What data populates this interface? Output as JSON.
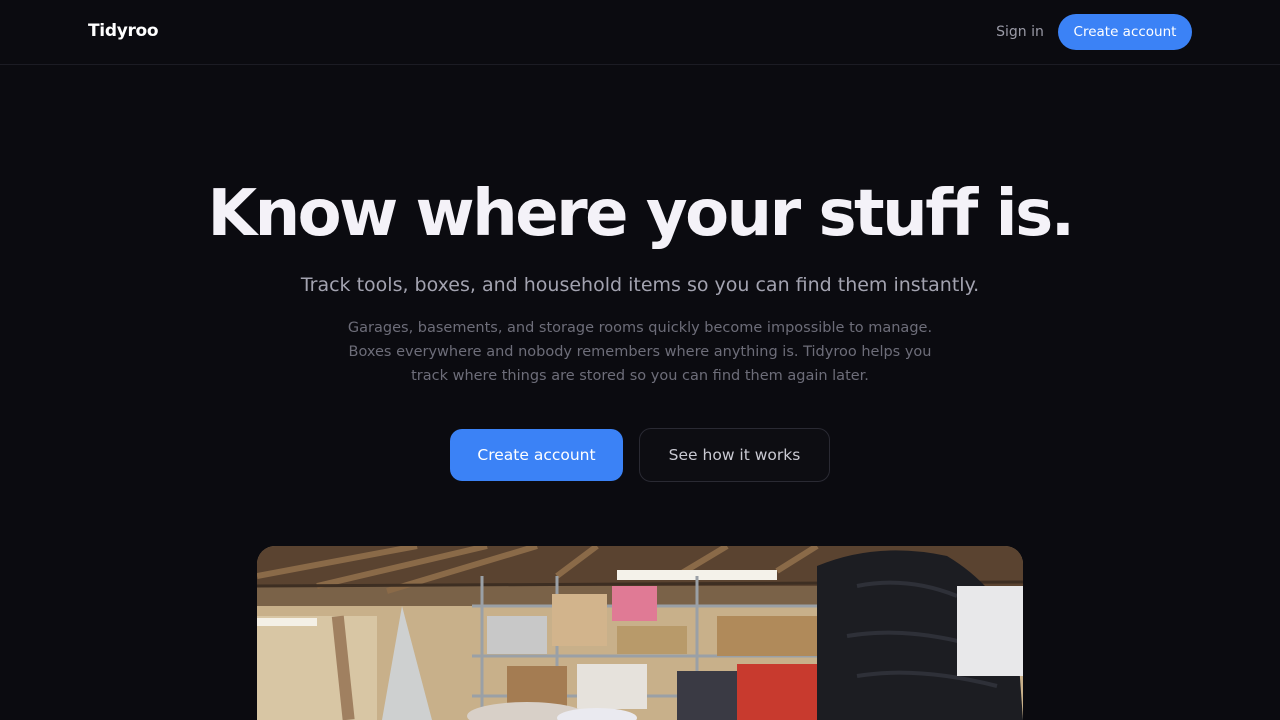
{
  "nav": {
    "logo": "Tidyroo",
    "sign_in": "Sign in",
    "create_account": "Create account"
  },
  "hero": {
    "title": "Know where your stuff is.",
    "subtitle": "Track tools, boxes, and household items so you can find them instantly.",
    "description": "Garages, basements, and storage rooms quickly become impossible to manage. Boxes everywhere and nobody remembers where anything is. Tidyroo helps you track where things are stored so you can find them again later.",
    "primary_cta": "Create account",
    "secondary_cta": "See how it works"
  },
  "colors": {
    "background": "#0b0b10",
    "accent": "#3b82f6"
  }
}
